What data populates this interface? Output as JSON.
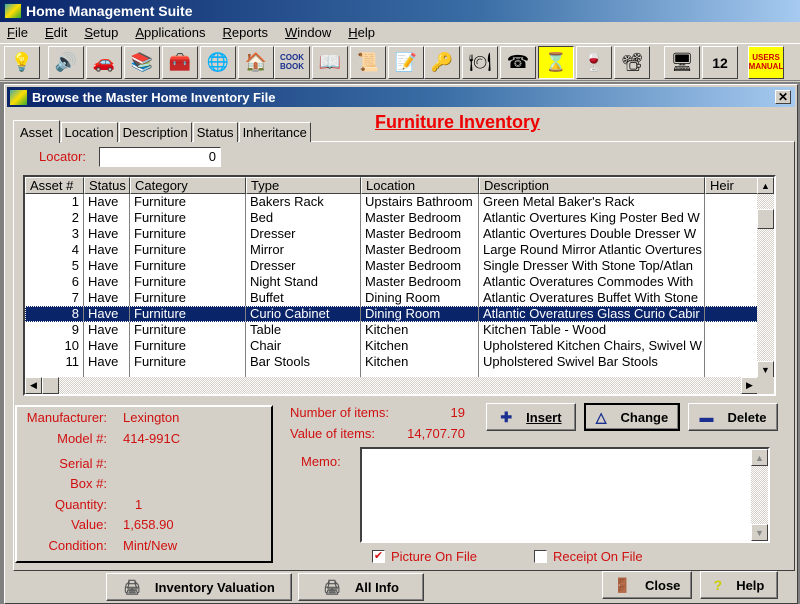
{
  "app": {
    "title": "Home Management Suite",
    "menu": [
      {
        "label": "File",
        "accel": "F",
        "rest": "ile"
      },
      {
        "label": "Edit",
        "accel": "E",
        "rest": "dit"
      },
      {
        "label": "Setup",
        "accel": "S",
        "rest": "etup"
      },
      {
        "label": "Applications",
        "accel": "A",
        "rest": "pplications"
      },
      {
        "label": "Reports",
        "accel": "R",
        "rest": "eports"
      },
      {
        "label": "Window",
        "accel": "W",
        "rest": "indow"
      },
      {
        "label": "Help",
        "accel": "H",
        "rest": "elp"
      }
    ],
    "toolbar": [
      {
        "name": "lightbulb-icon",
        "glyph": "💡"
      },
      {
        "name": "speaker-icon",
        "glyph": "🔊"
      },
      {
        "name": "car-icon",
        "glyph": "🚗"
      },
      {
        "name": "books-icon",
        "glyph": "📚"
      },
      {
        "name": "chest-icon",
        "glyph": "🧰"
      },
      {
        "name": "globe-icon",
        "glyph": "🌐"
      },
      {
        "name": "house-icon",
        "glyph": "🏠"
      },
      {
        "name": "cookbook-icon",
        "glyph": "COOK BOOK"
      },
      {
        "name": "open-book-icon",
        "glyph": "📖"
      },
      {
        "name": "scroll-icon",
        "glyph": "📜"
      },
      {
        "name": "notepad-icon",
        "glyph": "📝"
      },
      {
        "name": "key-icon",
        "glyph": "🔑"
      },
      {
        "name": "serving-tray-icon",
        "glyph": "🍽"
      },
      {
        "name": "telephone-icon",
        "glyph": "☎"
      },
      {
        "name": "hourglass-icon",
        "glyph": "⌛"
      },
      {
        "name": "wine-icon",
        "glyph": "🍷"
      },
      {
        "name": "projector-icon",
        "glyph": "📽"
      },
      {
        "name": "computer-icon",
        "glyph": "🖥"
      },
      {
        "name": "calendar-icon",
        "glyph": "12"
      },
      {
        "name": "users-manual-icon",
        "glyph": "USERS MANUAL"
      }
    ]
  },
  "dialog": {
    "title": "Browse the Master Home Inventory File",
    "heading": "Furniture Inventory",
    "tabs": [
      "Asset",
      "Location",
      "Description",
      "Status",
      "Inheritance"
    ],
    "active_tab": "Asset",
    "locator": {
      "label": "Locator:",
      "value": "0"
    },
    "grid": {
      "columns": [
        "Asset #",
        "Status",
        "Category",
        "Type",
        "Location",
        "Description",
        "Heir"
      ],
      "rows": [
        [
          "1",
          "Have",
          "Furniture",
          "Bakers Rack",
          "Upstairs Bathroom",
          "Green Metal Baker's Rack",
          ""
        ],
        [
          "2",
          "Have",
          "Furniture",
          "Bed",
          "Master Bedroom",
          "Atlantic Overtures King Poster Bed W",
          ""
        ],
        [
          "3",
          "Have",
          "Furniture",
          "Dresser",
          "Master Bedroom",
          "Atlantic Overtures Double Dresser W",
          ""
        ],
        [
          "4",
          "Have",
          "Furniture",
          "Mirror",
          "Master Bedroom",
          "Large Round Mirror Atlantic Overtures",
          ""
        ],
        [
          "5",
          "Have",
          "Furniture",
          "Dresser",
          "Master Bedroom",
          "Single Dresser With Stone Top/Atlan",
          ""
        ],
        [
          "6",
          "Have",
          "Furniture",
          "Night Stand",
          "Master Bedroom",
          "Atlantic Overatures Commodes With",
          ""
        ],
        [
          "7",
          "Have",
          "Furniture",
          "Buffet",
          "Dining Room",
          "Atlantic Overatures Buffet With Stone",
          ""
        ],
        [
          "8",
          "Have",
          "Furniture",
          "Curio Cabinet",
          "Dining Room",
          "Atlantic Overatures Glass Curio Cabir",
          ""
        ],
        [
          "9",
          "Have",
          "Furniture",
          "Table",
          "Kitchen",
          "Kitchen Table - Wood",
          ""
        ],
        [
          "10",
          "Have",
          "Furniture",
          "Chair",
          "Kitchen",
          "Upholstered Kitchen Chairs, Swivel W",
          ""
        ],
        [
          "11",
          "Have",
          "Furniture",
          "Bar Stools",
          "Kitchen",
          "Upholstered Swivel Bar Stools",
          ""
        ]
      ],
      "selected_asset": "8"
    },
    "details": [
      {
        "label": "Manufacturer:",
        "value": "Lexington"
      },
      {
        "label": "Model #:",
        "value": "414-991C"
      },
      {
        "label": "Serial #:",
        "value": ""
      },
      {
        "label": "Box #:",
        "value": ""
      },
      {
        "label": "Quantity:",
        "value": "1"
      },
      {
        "label": "Value:",
        "value": "1,658.90"
      },
      {
        "label": "Condition:",
        "value": "Mint/New"
      }
    ],
    "stats": {
      "count_label": "Number of items:",
      "count": "19",
      "value_label": "Value of items:",
      "value": "14,707.70"
    },
    "buttons": {
      "insert": "Insert",
      "change": "Change",
      "delete": "Delete",
      "inventory_valuation": "Inventory Valuation",
      "all_info": "All Info",
      "close": "Close",
      "help": "Help"
    },
    "memo": {
      "label": "Memo:",
      "value": ""
    },
    "checkboxes": [
      {
        "label": "Picture On File",
        "checked": true
      },
      {
        "label": "Receipt On File",
        "checked": false
      }
    ]
  }
}
